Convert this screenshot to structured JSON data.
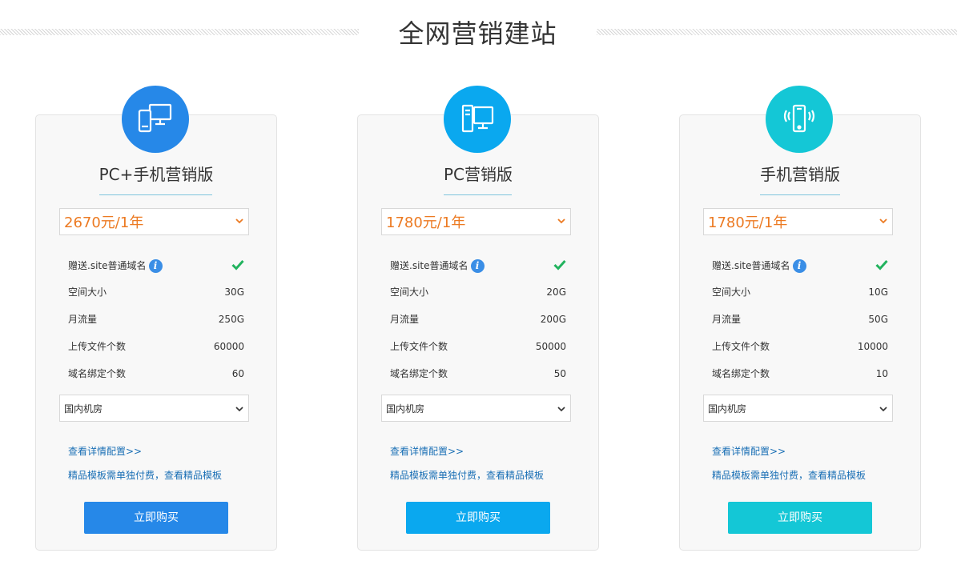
{
  "page": {
    "title": "全网营销建站"
  },
  "cards": [
    {
      "name": "PC+手机营销版",
      "price": "2670元/1年",
      "domain_gift": {
        "label": "赠送.site普通域名",
        "info_icon": "info-icon",
        "status_icon": "check-icon"
      },
      "specs": [
        {
          "label": "空间大小",
          "value": "30G"
        },
        {
          "label": "月流量",
          "value": "250G"
        },
        {
          "label": "上传文件个数",
          "value": "60000"
        },
        {
          "label": "域名绑定个数",
          "value": "60"
        }
      ],
      "room": "国内机房",
      "details_link": "查看详情配置>>",
      "template_link": "精品模板需单独付费，查看精品模板",
      "buy_label": "立即购买",
      "icon": "pc-and-mobile-icon",
      "color": "#2688e8"
    },
    {
      "name": "PC营销版",
      "price": "1780元/1年",
      "domain_gift": {
        "label": "赠送.site普通域名",
        "info_icon": "info-icon",
        "status_icon": "check-icon"
      },
      "specs": [
        {
          "label": "空间大小",
          "value": "20G"
        },
        {
          "label": "月流量",
          "value": "200G"
        },
        {
          "label": "上传文件个数",
          "value": "50000"
        },
        {
          "label": "域名绑定个数",
          "value": "50"
        }
      ],
      "room": "国内机房",
      "details_link": "查看详情配置>>",
      "template_link": "精品模板需单独付费，查看精品模板",
      "buy_label": "立即购买",
      "icon": "desktop-pc-icon",
      "color": "#0aa8ef"
    },
    {
      "name": "手机营销版",
      "price": "1780元/1年",
      "domain_gift": {
        "label": "赠送.site普通域名",
        "info_icon": "info-icon",
        "status_icon": "check-icon"
      },
      "specs": [
        {
          "label": "空间大小",
          "value": "10G"
        },
        {
          "label": "月流量",
          "value": "50G"
        },
        {
          "label": "上传文件个数",
          "value": "10000"
        },
        {
          "label": "域名绑定个数",
          "value": "10"
        }
      ],
      "room": "国内机房",
      "details_link": "查看详情配置>>",
      "template_link": "精品模板需单独付费，查看精品模板",
      "buy_label": "立即购买",
      "icon": "mobile-phone-icon",
      "color": "#14c7d6"
    }
  ],
  "colors": {
    "price": "#ec7a22",
    "link": "#1a6fb5",
    "check": "#22b35e",
    "info": "#3a8ee6"
  }
}
